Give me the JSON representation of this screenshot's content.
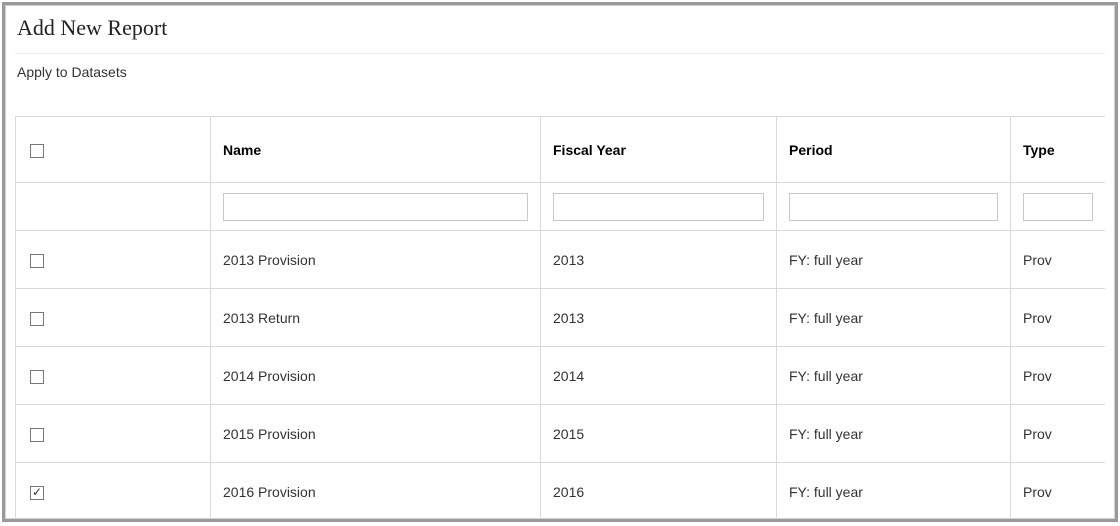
{
  "page": {
    "title": "Add New Report",
    "section_label": "Apply to Datasets"
  },
  "table": {
    "headers": {
      "name": "Name",
      "fiscal_year": "Fiscal Year",
      "period": "Period",
      "type": "Type"
    },
    "filters": {
      "name": "",
      "fiscal_year": "",
      "period": "",
      "type": ""
    },
    "rows": [
      {
        "checked": false,
        "name": "2013 Provision",
        "fiscal_year": "2013",
        "period": "FY: full year",
        "type": "Prov"
      },
      {
        "checked": false,
        "name": "2013 Return",
        "fiscal_year": "2013",
        "period": "FY: full year",
        "type": "Prov"
      },
      {
        "checked": false,
        "name": "2014 Provision",
        "fiscal_year": "2014",
        "period": "FY: full year",
        "type": "Prov"
      },
      {
        "checked": false,
        "name": "2015 Provision",
        "fiscal_year": "2015",
        "period": "FY: full year",
        "type": "Prov"
      },
      {
        "checked": true,
        "name": "2016 Provision",
        "fiscal_year": "2016",
        "period": "FY: full year",
        "type": "Prov"
      }
    ]
  }
}
